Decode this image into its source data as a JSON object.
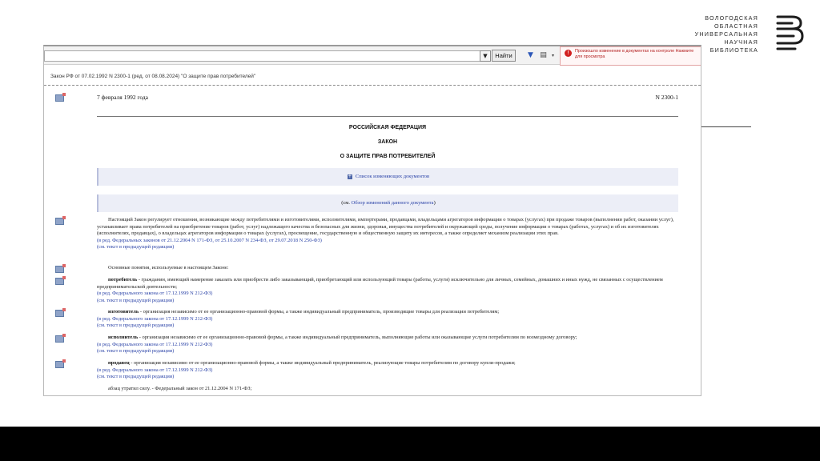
{
  "logo": {
    "lines": [
      "ВОЛОГОДСКАЯ",
      "ОБЛАСТНАЯ",
      "УНИВЕРСАЛЬНАЯ",
      "НАУЧНАЯ",
      "БИБЛИОТЕКА"
    ]
  },
  "toolbar": {
    "search_value": "",
    "dropdown_glyph": "▼",
    "find_label": "Найти",
    "notice": "Произошло изменение в документах на контроле Нажмите для просмотра"
  },
  "document": {
    "name": "Закон РФ от 07.02.1992 N 2300-1 (ред. от 08.08.2024) \"О защите прав потребителей\"",
    "date": "7 февраля 1992 года",
    "number": "N 2300-1",
    "country": "РОССИЙСКАЯ ФЕДЕРАЦИЯ",
    "type": "ЗАКОН",
    "title": "О ЗАЩИТЕ ПРАВ ПОТРЕБИТЕЛЕЙ",
    "box1": "Список изменяющих документов",
    "box2_prefix": "(см. ",
    "box2_link": "Обзор изменений данного документа",
    "box2_suffix": ")",
    "paragraphs": [
      {
        "text": "Настоящий Закон регулирует отношения, возникающие между потребителями и изготовителями, исполнителями, импортерами, продавцами, владельцами агрегаторов информации о товарах (услугах) при продаже товаров (выполнении работ, оказании услуг), устанавливает права потребителей на приобретение товаров (работ, услуг) надлежащего качества и безопасных для жизни, здоровья, имущества потребителей и окружающей среды, получение информации о товарах (работах, услугах) и об их изготовителях (исполнителях, продавцах), о владельцах агрегаторов информации о товарах (услугах), просвещение, государственную и общественную защиту их интересов, а также определяет механизм реализации этих прав.",
        "ref": "(в ред. Федеральных законов от 21.12.2004 N 171-ФЗ, от 25.10.2007 N 234-ФЗ, от 29.07.2018 N 250-ФЗ)",
        "ref2": "(см. текст в предыдущей редакции)"
      },
      {
        "text": "Основные понятия, используемые в настоящем Законе:"
      },
      {
        "term": "потребитель",
        "text": " - гражданин, имеющий намерение заказать или приобрести либо заказывающий, приобретающий или использующий товары (работы, услуги) исключительно для личных, семейных, домашних и иных нужд, не связанных с осуществлением предпринимательской деятельности;",
        "ref": "(в ред. Федерального закона от 17.12.1999 N 212-ФЗ)",
        "ref2": "(см. текст в предыдущей редакции)"
      },
      {
        "term": "изготовитель",
        "text": " - организация независимо от ее организационно-правовой формы, а также индивидуальный предприниматель, производящие товары для реализации потребителям;",
        "ref": "(в ред. Федерального закона от 17.12.1999 N 212-ФЗ)",
        "ref2": "(см. текст в предыдущей редакции)"
      },
      {
        "term": "исполнитель",
        "text": " - организация независимо от ее организационно-правовой формы, а также индивидуальный предприниматель, выполняющие работы или оказывающие услуги потребителям по возмездному договору;",
        "ref": "(в ред. Федерального закона от 17.12.1999 N 212-ФЗ)",
        "ref2": "(см. текст в предыдущей редакции)"
      },
      {
        "term": "продавец",
        "text": " - организация независимо от ее организационно-правовой формы, а также индивидуальный предприниматель, реализующие товары потребителям по договору купли-продажи;",
        "ref": "(в ред. Федерального закона от 17.12.1999 N 212-ФЗ)",
        "ref2": "(см. текст в предыдущей редакции)"
      },
      {
        "text": "абзац утратил силу. - Федеральный закон от 21.12.2004 N 171-ФЗ;"
      }
    ]
  }
}
